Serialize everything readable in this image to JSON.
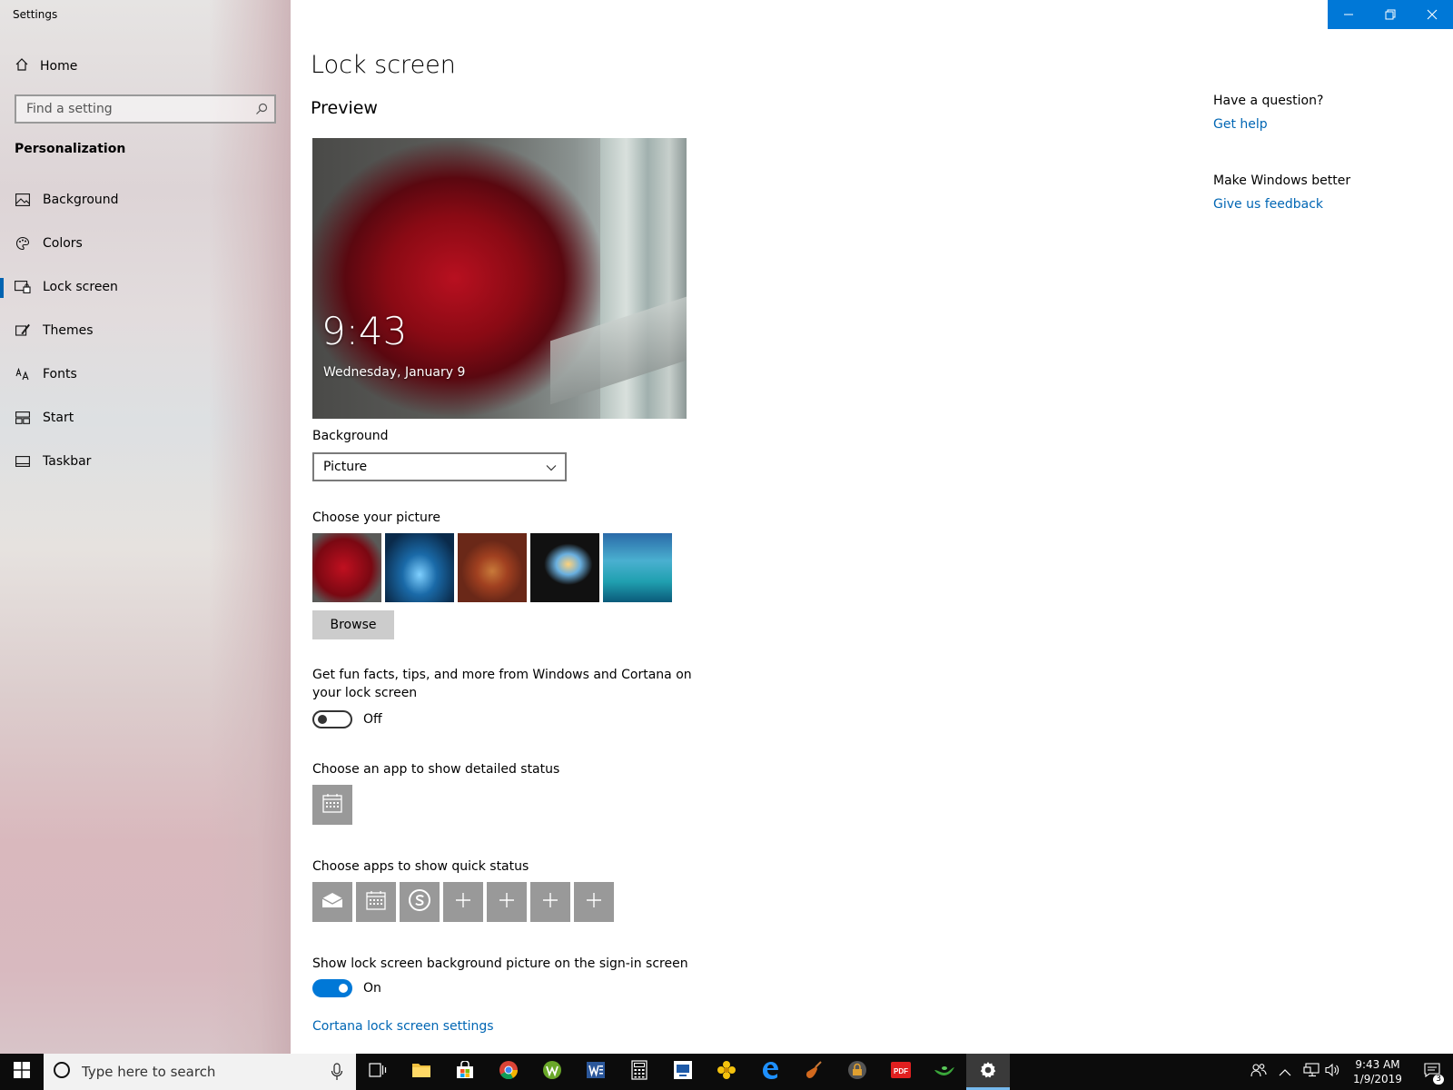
{
  "window": {
    "title": "Settings"
  },
  "sidebar": {
    "home_label": "Home",
    "search_placeholder": "Find a setting",
    "section_title": "Personalization",
    "items": [
      {
        "label": "Background",
        "icon": "picture-icon"
      },
      {
        "label": "Colors",
        "icon": "palette-icon"
      },
      {
        "label": "Lock screen",
        "icon": "lock-screen-icon",
        "active": true
      },
      {
        "label": "Themes",
        "icon": "themes-icon"
      },
      {
        "label": "Fonts",
        "icon": "fonts-icon"
      },
      {
        "label": "Start",
        "icon": "start-icon"
      },
      {
        "label": "Taskbar",
        "icon": "taskbar-icon"
      }
    ]
  },
  "main": {
    "title": "Lock screen",
    "preview_label": "Preview",
    "preview_time": "9:43",
    "preview_date": "Wednesday, January 9",
    "background_label": "Background",
    "background_value": "Picture",
    "choose_picture_label": "Choose your picture",
    "browse_label": "Browse",
    "fun_facts_label": "Get fun facts, tips, and more from Windows and Cortana on your lock screen",
    "fun_facts_state": "Off",
    "detailed_status_label": "Choose an app to show detailed status",
    "quick_status_label": "Choose apps to show quick status",
    "signin_label": "Show lock screen background picture on the sign-in screen",
    "signin_state": "On",
    "cortana_link": "Cortana lock screen settings"
  },
  "help": {
    "question": "Have a question?",
    "get_help": "Get help",
    "make_better": "Make Windows better",
    "feedback": "Give us feedback"
  },
  "taskbar": {
    "search_placeholder": "Type here to search",
    "time": "9:43 AM",
    "date": "1/9/2019",
    "notification_count": "3"
  },
  "colors": {
    "accent": "#0078d7",
    "link": "#0066b4"
  }
}
